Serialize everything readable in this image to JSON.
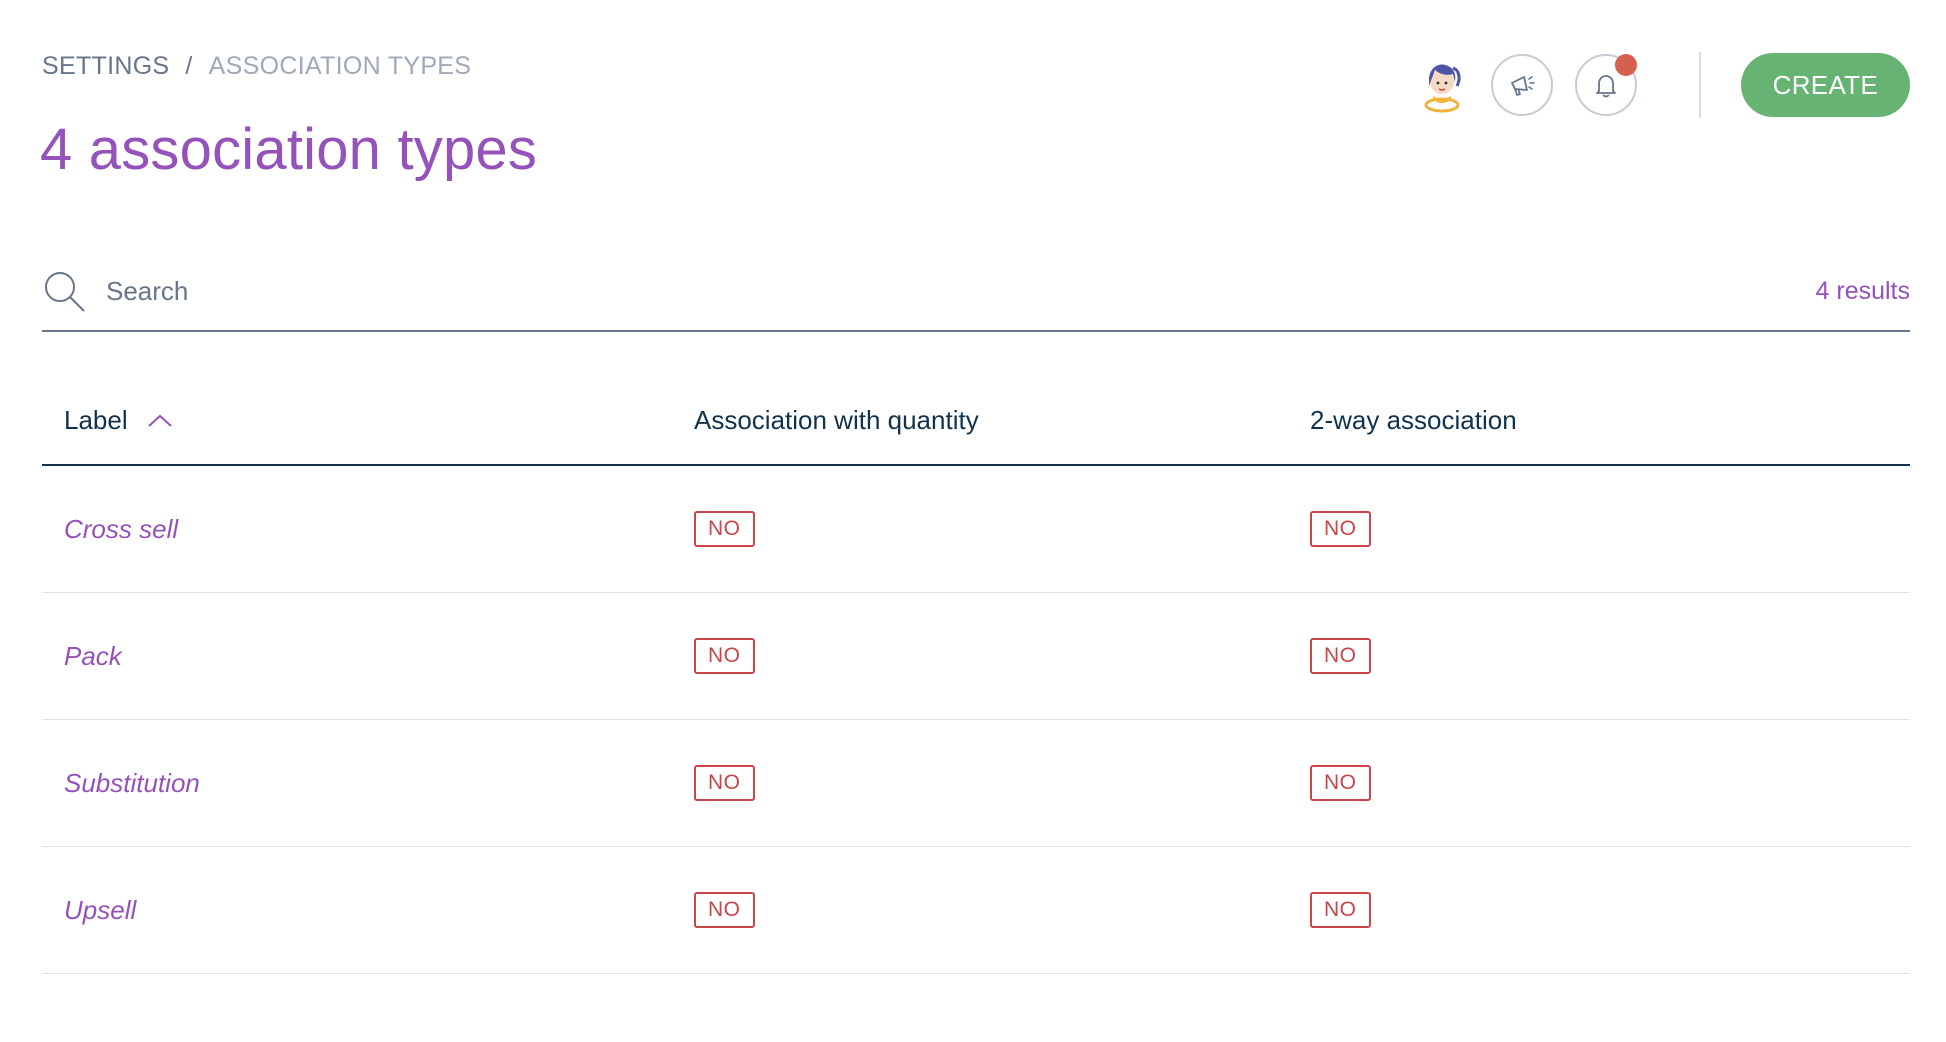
{
  "breadcrumb": {
    "settings": "SETTINGS",
    "separator": "/",
    "current": "ASSOCIATION TYPES"
  },
  "page": {
    "title": "4 association types"
  },
  "header": {
    "create_label": "CREATE",
    "icons": [
      "avatar-illustration",
      "megaphone-icon",
      "bell-icon"
    ],
    "has_notification": true
  },
  "search": {
    "placeholder": "Search",
    "value": "",
    "results": "4 results"
  },
  "table": {
    "columns": [
      {
        "label": "Label",
        "sorted": "ascending"
      },
      {
        "label": "Association with quantity"
      },
      {
        "label": "2-way association"
      }
    ],
    "rows": [
      {
        "label": "Cross sell",
        "quantity": "NO",
        "two_way": "NO"
      },
      {
        "label": "Pack",
        "quantity": "NO",
        "two_way": "NO"
      },
      {
        "label": "Substitution",
        "quantity": "NO",
        "two_way": "NO"
      },
      {
        "label": "Upsell",
        "quantity": "NO",
        "two_way": "NO"
      }
    ]
  },
  "colors": {
    "accent_purple": "#9452ba",
    "create_green": "#67b373",
    "badge_red": "#c9454a",
    "notification_red": "#d4604f",
    "text_dark": "#11324d",
    "text_grey": "#67768a"
  }
}
